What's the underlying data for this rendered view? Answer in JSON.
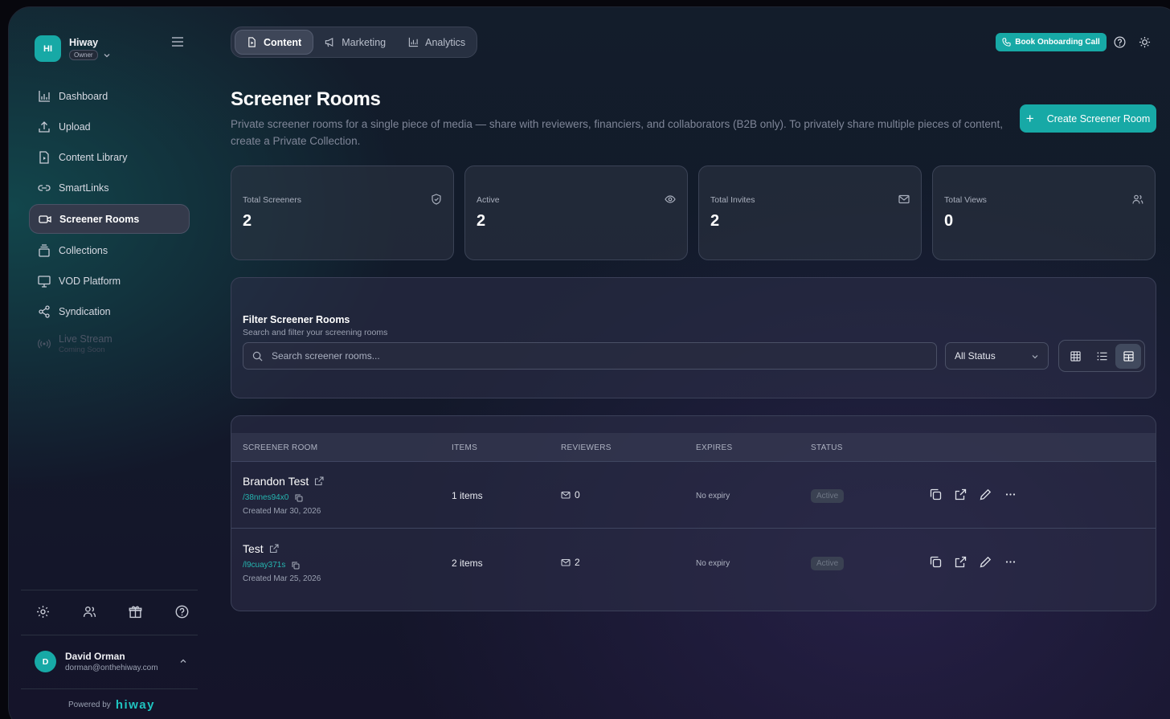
{
  "brand": {
    "initials": "HI",
    "name": "Hiway",
    "role": "Owner"
  },
  "sidebar": {
    "items": [
      {
        "label": "Dashboard",
        "icon": "bar-chart-icon"
      },
      {
        "label": "Upload",
        "icon": "upload-icon"
      },
      {
        "label": "Content Library",
        "icon": "file-video-icon"
      },
      {
        "label": "SmartLinks",
        "icon": "link-icon"
      },
      {
        "label": "Screener Rooms",
        "icon": "video-camera-icon",
        "active": true
      },
      {
        "label": "Collections",
        "icon": "collections-icon"
      },
      {
        "label": "VOD Platform",
        "icon": "monitor-icon"
      },
      {
        "label": "Syndication",
        "icon": "share-icon"
      },
      {
        "label": "Live Stream",
        "sub": "Coming Soon",
        "icon": "broadcast-icon",
        "disabled": true
      }
    ],
    "utility_icons": [
      "settings-icon",
      "users-icon",
      "gift-icon",
      "help-icon"
    ]
  },
  "user": {
    "initial": "D",
    "name": "David Orman",
    "email": "dorman@onthehiway.com"
  },
  "powered": {
    "label": "Powered by",
    "logo": "hiway"
  },
  "topnav": {
    "tabs": [
      {
        "label": "Content",
        "active": true
      },
      {
        "label": "Marketing"
      },
      {
        "label": "Analytics"
      }
    ],
    "onboarding_button": "Book Onboarding Call"
  },
  "header": {
    "title": "Screener Rooms",
    "description": "Private screener rooms for a single piece of media — share with reviewers, financiers, and collaborators (B2B only). To privately share multiple pieces of content, create a Private Collection.",
    "create_button": "Create Screener Room"
  },
  "stats": [
    {
      "label": "Total Screeners",
      "value": "2",
      "icon": "shield-icon"
    },
    {
      "label": "Active",
      "value": "2",
      "icon": "eye-icon"
    },
    {
      "label": "Total Invites",
      "value": "2",
      "icon": "mail-icon"
    },
    {
      "label": "Total Views",
      "value": "0",
      "icon": "users-icon"
    }
  ],
  "filter": {
    "title": "Filter Screener Rooms",
    "subtitle": "Search and filter your screening rooms",
    "search_placeholder": "Search screener rooms...",
    "status_value": "All Status"
  },
  "table": {
    "columns": [
      "SCREENER ROOM",
      "ITEMS",
      "REVIEWERS",
      "EXPIRES",
      "STATUS"
    ],
    "rows": [
      {
        "name": "Brandon Test",
        "slug": "/38nnes94x0",
        "created": "Created Mar 30, 2026",
        "items": "1 items",
        "reviewers": "0",
        "expires": "No expiry",
        "status": "Active"
      },
      {
        "name": "Test",
        "slug": "/l9cuay371s",
        "created": "Created Mar 25, 2026",
        "items": "2 items",
        "reviewers": "2",
        "expires": "No expiry",
        "status": "Active"
      }
    ]
  },
  "colors": {
    "accent": "#17a9a6",
    "background": "#121a2a",
    "card": "#2d3444"
  }
}
